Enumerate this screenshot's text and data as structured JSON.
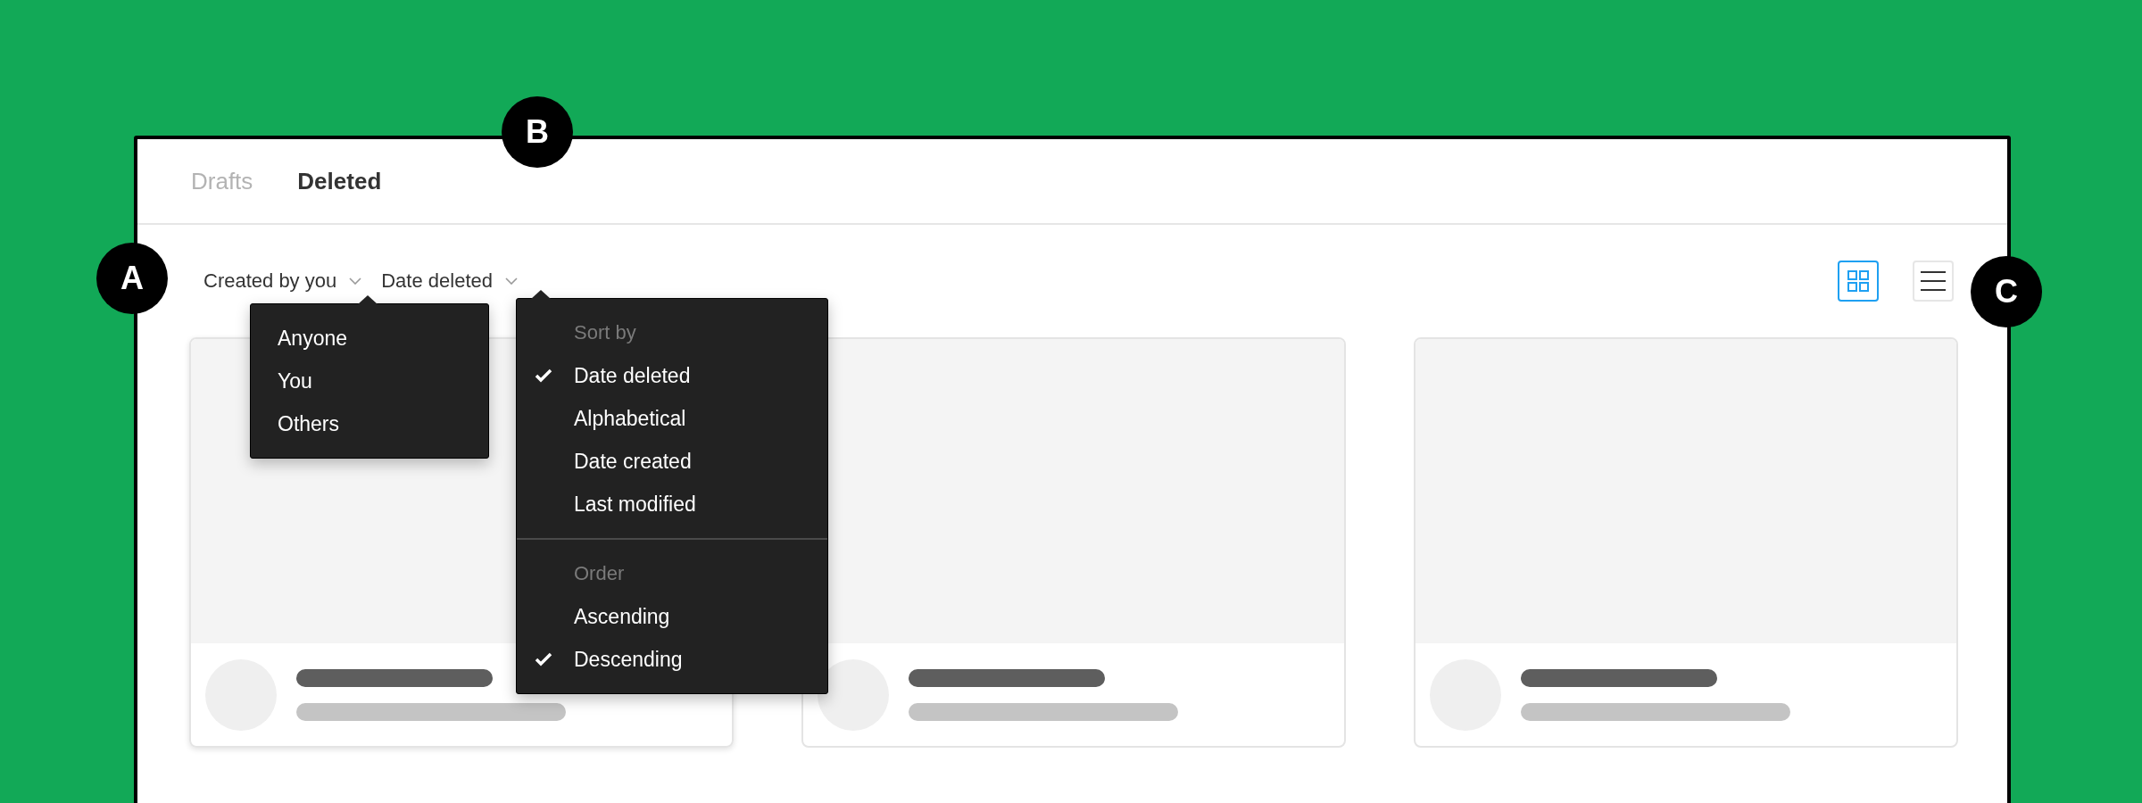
{
  "tabs": [
    {
      "label": "Drafts",
      "selected": false
    },
    {
      "label": "Deleted",
      "selected": true
    }
  ],
  "filters": [
    {
      "label": "Created by you"
    },
    {
      "label": "Date deleted"
    }
  ],
  "owner_menu": {
    "items": [
      {
        "label": "Anyone"
      },
      {
        "label": "You"
      },
      {
        "label": "Others"
      }
    ]
  },
  "sort_menu": {
    "sections": [
      {
        "heading": "Sort by",
        "items": [
          {
            "label": "Date deleted",
            "checked": true
          },
          {
            "label": "Alphabetical",
            "checked": false
          },
          {
            "label": "Date created",
            "checked": false
          },
          {
            "label": "Last modified",
            "checked": false
          }
        ]
      },
      {
        "heading": "Order",
        "items": [
          {
            "label": "Ascending",
            "checked": false
          },
          {
            "label": "Descending",
            "checked": true
          }
        ]
      }
    ]
  },
  "view_toggle": [
    {
      "kind": "grid",
      "selected": true
    },
    {
      "kind": "list",
      "selected": false
    }
  ],
  "cards": [
    {
      "kind": "skeleton"
    },
    {
      "kind": "skeleton"
    },
    {
      "kind": "skeleton"
    }
  ],
  "callouts": [
    {
      "label": "A"
    },
    {
      "label": "B"
    },
    {
      "label": "C"
    }
  ]
}
